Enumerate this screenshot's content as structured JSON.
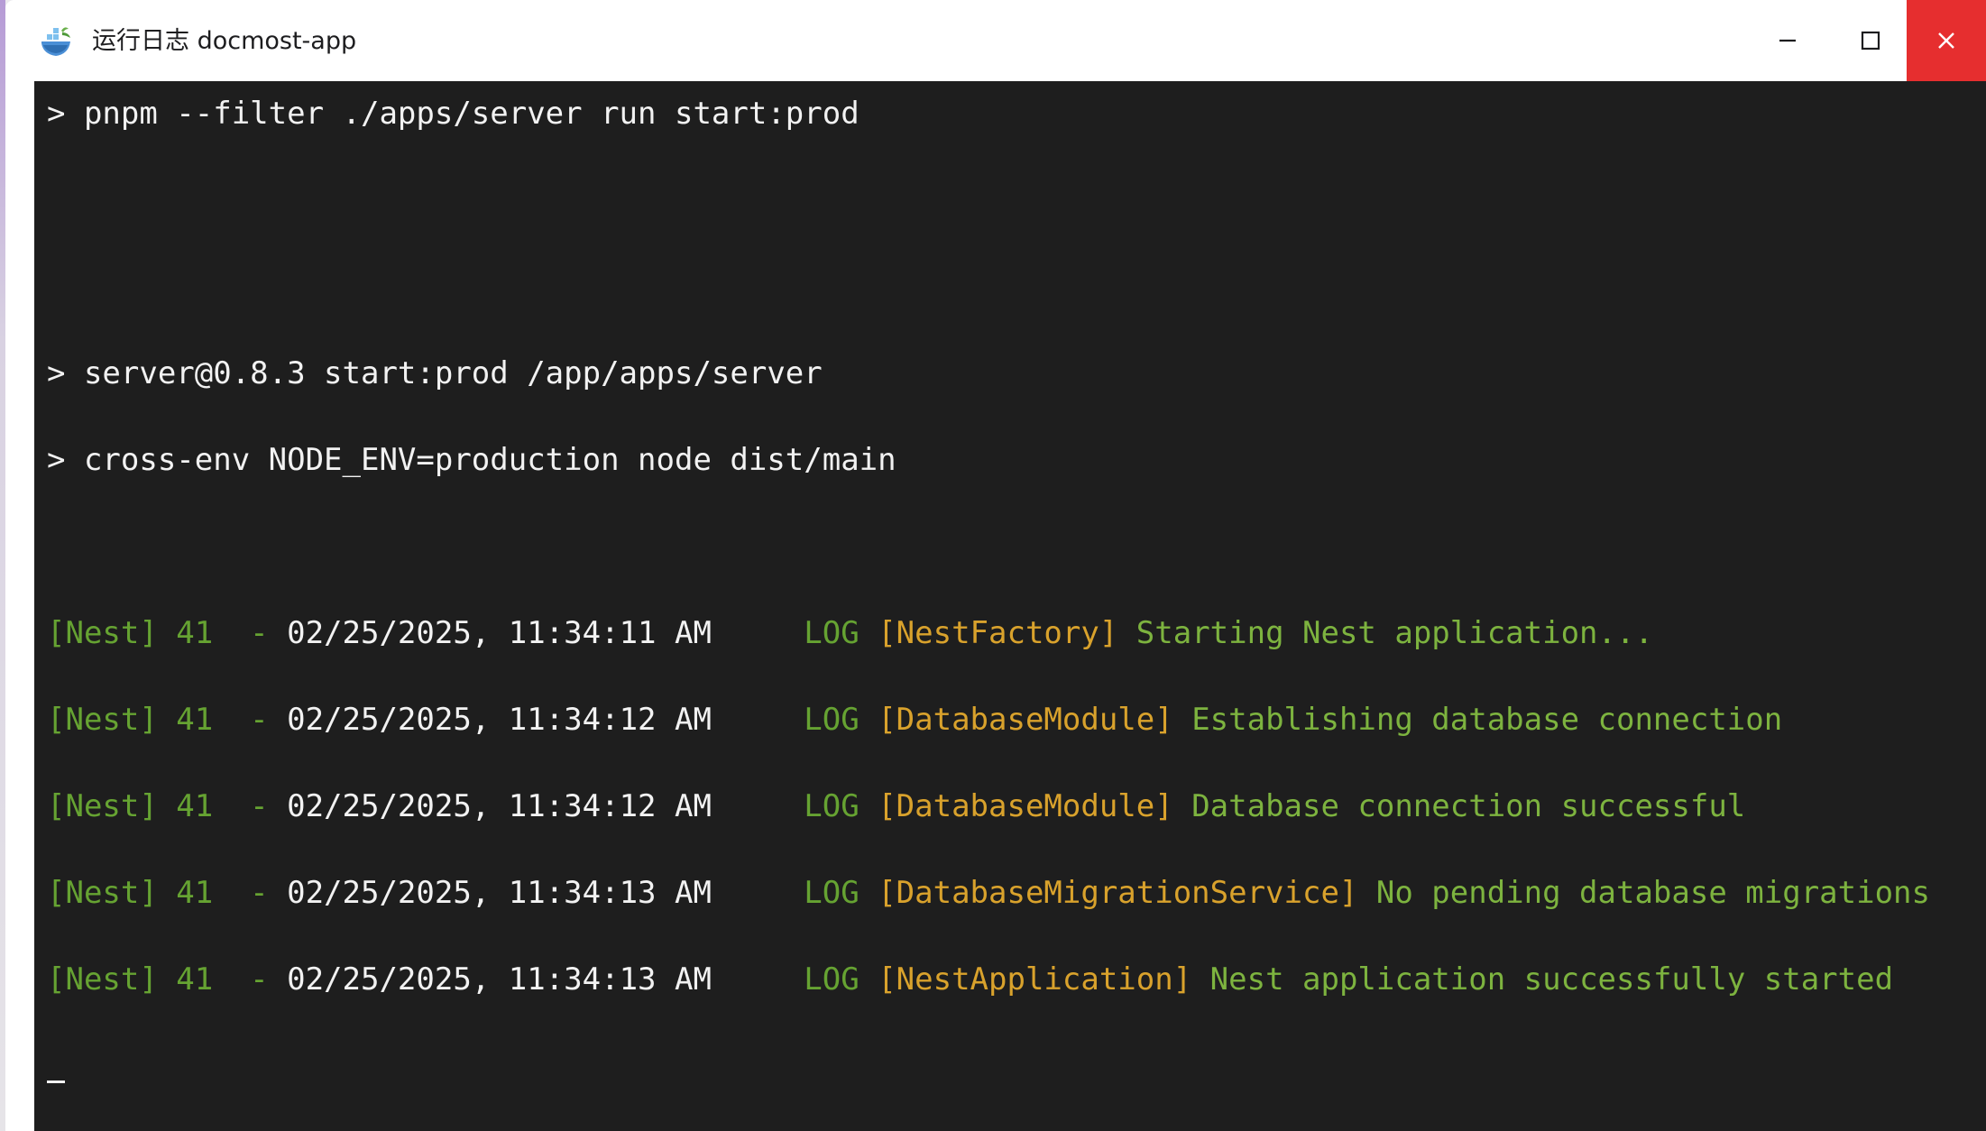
{
  "window": {
    "title": "运行日志 docmost-app",
    "icons": {
      "app": "docker-whale-icon",
      "minimize": "minimize-icon",
      "maximize": "maximize-icon",
      "close": "close-icon"
    },
    "colors": {
      "close_button": "#e62e2f",
      "terminal_bg": "#1e1e1e",
      "text": "#f2f2f2",
      "nest_green": "#66a332",
      "context_yellow": "#d9a22c"
    }
  },
  "terminal": {
    "lines": [
      {
        "text": "> pnpm --filter ./apps/server run start:prod"
      },
      {
        "text": "> server@0.8.3 start:prod /app/apps/server"
      },
      {
        "text": "> cross-env NODE_ENV=production node dist/main"
      }
    ],
    "logs": [
      {
        "prefix": "[Nest] 41  - ",
        "timestamp": "02/25/2025, 11:34:11 AM",
        "level": "LOG",
        "context": "[NestFactory]",
        "message": "Starting Nest application..."
      },
      {
        "prefix": "[Nest] 41  - ",
        "timestamp": "02/25/2025, 11:34:12 AM",
        "level": "LOG",
        "context": "[DatabaseModule]",
        "message": "Establishing database connection"
      },
      {
        "prefix": "[Nest] 41  - ",
        "timestamp": "02/25/2025, 11:34:12 AM",
        "level": "LOG",
        "context": "[DatabaseModule]",
        "message": "Database connection successful"
      },
      {
        "prefix": "[Nest] 41  - ",
        "timestamp": "02/25/2025, 11:34:13 AM",
        "level": "LOG",
        "context": "[DatabaseMigrationService]",
        "message": "No pending database migrations"
      },
      {
        "prefix": "[Nest] 41  - ",
        "timestamp": "02/25/2025, 11:34:13 AM",
        "level": "LOG",
        "context": "[NestApplication]",
        "message": "Nest application successfully started"
      }
    ]
  }
}
